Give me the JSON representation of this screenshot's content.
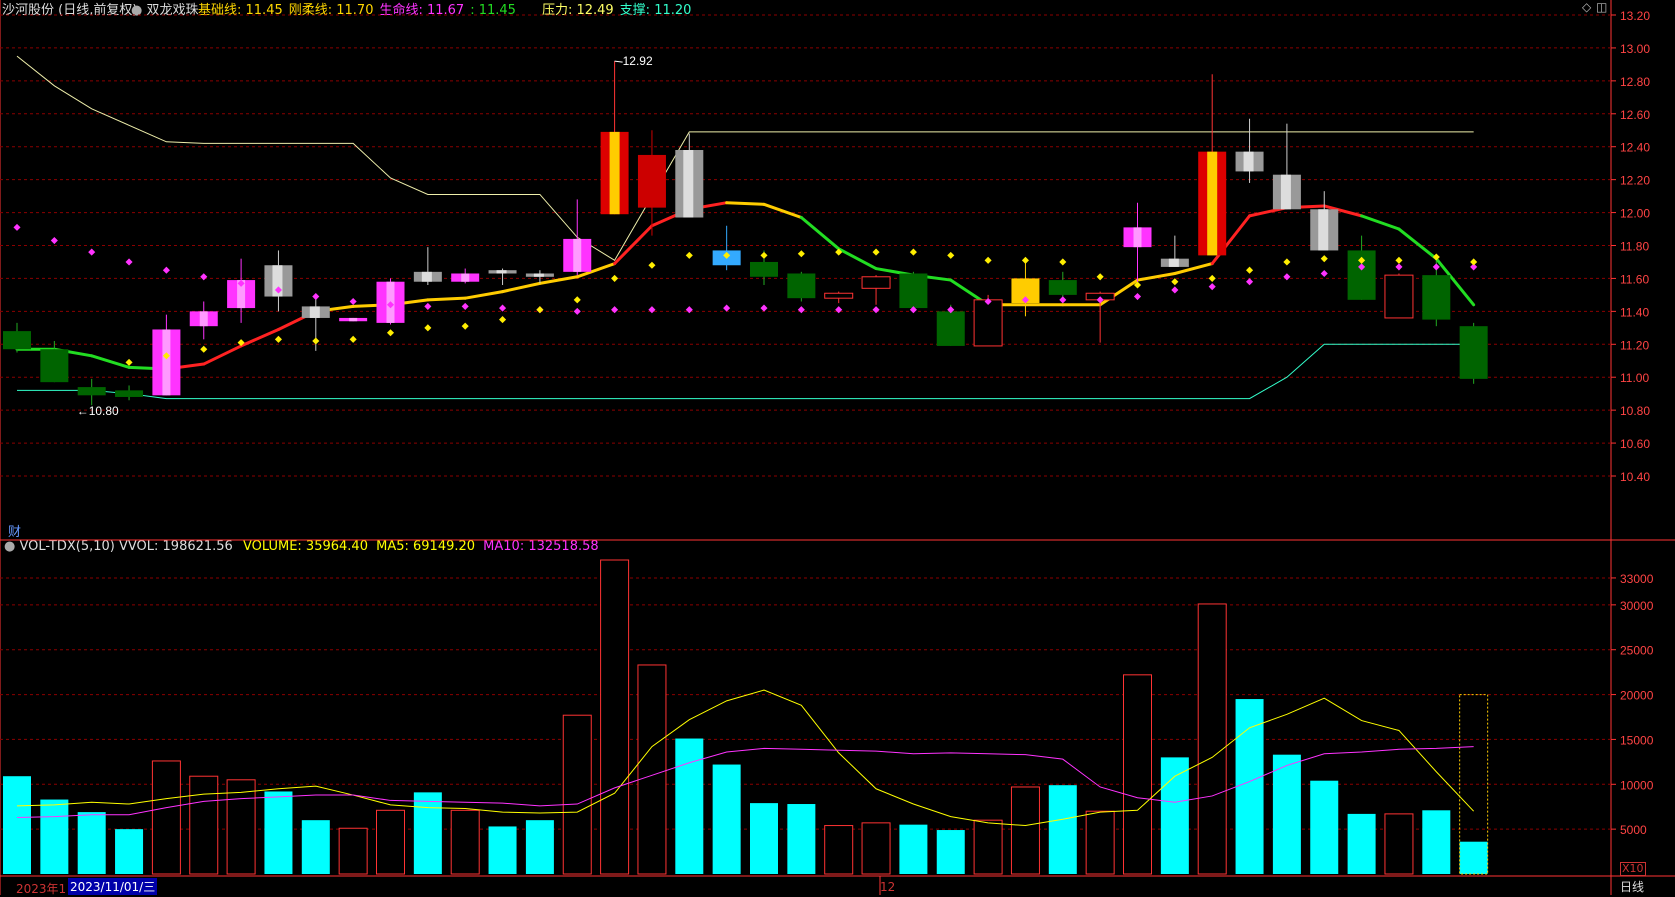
{
  "header": {
    "stock_name": "沙河股份",
    "chart_mode": "(日线,前复权)",
    "indicator_name": "双龙戏珠",
    "items": [
      {
        "label": "基础线: ",
        "value": "11.45",
        "color": "#FFD700"
      },
      {
        "label": "刚柔线: ",
        "value": "11.70",
        "color": "#FFD700"
      },
      {
        "label": "生命线: ",
        "value": "11.67",
        "color": "#FF33FF"
      },
      {
        "label": ": ",
        "value": "11.45",
        "color": "#22DD22"
      },
      {
        "label": "压力: ",
        "value": "12.49",
        "color": "#FFFF66"
      },
      {
        "label": "支撑: ",
        "value": "11.20",
        "color": "#33FFCC"
      }
    ]
  },
  "vol_header": {
    "name": "VOL-TDX(5,10)",
    "vvol": "VVOL: 198621.56",
    "volume": "VOLUME: 35964.40",
    "ma5": "MA5: 69149.20",
    "ma10": "MA10: 132518.58"
  },
  "finance_marker": "财",
  "date_bar": {
    "year": "2023年1",
    "date": "2023/11/01/三",
    "month": "12",
    "period": "日线",
    "multiplier": "X10"
  },
  "colors": {
    "up": "#FF3333",
    "down": "#00FFFF",
    "ma5": "#FFFF00",
    "ma10": "#FF33FF",
    "grid": "#8B0000",
    "axis": "#FF3333"
  },
  "chart_data": {
    "type": "candlestick",
    "price_axis": {
      "range": [
        10.4,
        13.2
      ],
      "ticks": [
        "13.20",
        "13.00",
        "12.80",
        "12.60",
        "12.40",
        "12.20",
        "12.00",
        "11.80",
        "11.60",
        "11.40",
        "11.20",
        "11.00",
        "10.80",
        "10.60",
        "10.40"
      ]
    },
    "annotations": [
      {
        "text": "12.92",
        "bar": 16,
        "price": 12.92
      },
      {
        "text": "10.80",
        "bar": 2,
        "price": 10.8
      }
    ],
    "candles": [
      {
        "o": 11.28,
        "h": 11.33,
        "l": 11.15,
        "c": 11.17,
        "col": "#006400"
      },
      {
        "o": 11.17,
        "h": 11.22,
        "l": 10.97,
        "c": 10.97,
        "col": "#006400"
      },
      {
        "o": 10.94,
        "h": 10.99,
        "l": 10.83,
        "c": 10.89,
        "col": "#006400"
      },
      {
        "o": 10.92,
        "h": 10.95,
        "l": 10.86,
        "c": 10.88,
        "col": "#006400"
      },
      {
        "o": 10.89,
        "h": 11.38,
        "l": 10.89,
        "c": 11.29,
        "col": "#FF33FF"
      },
      {
        "o": 11.31,
        "h": 11.46,
        "l": 11.23,
        "c": 11.4,
        "col": "#FF33FF"
      },
      {
        "o": 11.42,
        "h": 11.72,
        "l": 11.33,
        "c": 11.59,
        "col": "#FF33FF"
      },
      {
        "o": 11.68,
        "h": 11.77,
        "l": 11.4,
        "c": 11.49,
        "col": "#999999"
      },
      {
        "o": 11.43,
        "h": 11.48,
        "l": 11.16,
        "c": 11.36,
        "col": "#999999"
      },
      {
        "o": 11.34,
        "h": 11.36,
        "l": 11.34,
        "c": 11.36,
        "col": "#FF33FF"
      },
      {
        "o": 11.33,
        "h": 11.6,
        "l": 11.32,
        "c": 11.58,
        "col": "#FF33FF"
      },
      {
        "o": 11.64,
        "h": 11.79,
        "l": 11.56,
        "c": 11.58,
        "col": "#999999"
      },
      {
        "o": 11.58,
        "h": 11.66,
        "l": 11.57,
        "c": 11.63,
        "col": "#FF33FF"
      },
      {
        "o": 11.65,
        "h": 11.66,
        "l": 11.56,
        "c": 11.63,
        "col": "#999999"
      },
      {
        "o": 11.61,
        "h": 11.65,
        "l": 11.57,
        "c": 11.63,
        "col": "#999999"
      },
      {
        "o": 11.64,
        "h": 12.08,
        "l": 11.62,
        "c": 11.84,
        "col": "#FF33FF"
      },
      {
        "o": 11.99,
        "h": 12.92,
        "l": 11.99,
        "c": 12.49,
        "col": "gold"
      },
      {
        "o": 12.35,
        "h": 12.5,
        "l": 11.86,
        "c": 12.03,
        "col": "#CC0000"
      },
      {
        "o": 12.38,
        "h": 12.48,
        "l": 11.97,
        "c": 11.97,
        "col": "#999999"
      },
      {
        "o": 11.77,
        "h": 11.92,
        "l": 11.65,
        "c": 11.68,
        "col": "#33AAFF"
      },
      {
        "o": 11.7,
        "h": 11.77,
        "l": 11.56,
        "c": 11.61,
        "col": "#006400"
      },
      {
        "o": 11.63,
        "h": 11.64,
        "l": 11.46,
        "c": 11.48,
        "col": "#006400"
      },
      {
        "o": 11.48,
        "h": 11.52,
        "l": 11.45,
        "c": 11.51,
        "col": "hollow"
      },
      {
        "o": 11.54,
        "h": 11.62,
        "l": 11.44,
        "c": 11.61,
        "col": "hollow"
      },
      {
        "o": 11.63,
        "h": 11.64,
        "l": 11.4,
        "c": 11.42,
        "col": "#006400"
      },
      {
        "o": 11.4,
        "h": 11.44,
        "l": 11.19,
        "c": 11.19,
        "col": "#006400"
      },
      {
        "o": 11.19,
        "h": 11.5,
        "l": 11.19,
        "c": 11.47,
        "col": "hollow"
      },
      {
        "o": 11.45,
        "h": 11.7,
        "l": 11.37,
        "c": 11.6,
        "col": "#FFCC00"
      },
      {
        "o": 11.59,
        "h": 11.64,
        "l": 11.48,
        "c": 11.5,
        "col": "#006400"
      },
      {
        "o": 11.47,
        "h": 11.52,
        "l": 11.21,
        "c": 11.51,
        "col": "hollow"
      },
      {
        "o": 11.79,
        "h": 12.06,
        "l": 11.55,
        "c": 11.91,
        "col": "#FF33FF"
      },
      {
        "o": 11.72,
        "h": 11.86,
        "l": 11.67,
        "c": 11.67,
        "col": "#999999"
      },
      {
        "o": 11.74,
        "h": 12.84,
        "l": 11.74,
        "c": 12.37,
        "col": "gold"
      },
      {
        "o": 12.37,
        "h": 12.57,
        "l": 12.18,
        "c": 12.25,
        "col": "#999999"
      },
      {
        "o": 12.23,
        "h": 12.54,
        "l": 12.02,
        "c": 12.02,
        "col": "#999999"
      },
      {
        "o": 12.02,
        "h": 12.13,
        "l": 11.77,
        "c": 11.77,
        "col": "#999999"
      },
      {
        "o": 11.77,
        "h": 11.86,
        "l": 11.47,
        "c": 11.47,
        "col": "#006400"
      },
      {
        "o": 11.36,
        "h": 11.63,
        "l": 11.36,
        "c": 11.62,
        "col": "hollow"
      },
      {
        "o": 11.62,
        "h": 11.71,
        "l": 11.31,
        "c": 11.35,
        "col": "#006400"
      },
      {
        "o": 11.31,
        "h": 11.33,
        "l": 10.96,
        "c": 10.99,
        "col": "#006400"
      }
    ],
    "lifeline": [
      11.17,
      11.17,
      11.13,
      11.06,
      11.05,
      11.08,
      11.19,
      11.29,
      11.4,
      11.43,
      11.44,
      11.47,
      11.48,
      11.52,
      11.57,
      11.61,
      11.69,
      11.92,
      12.02,
      12.06,
      12.05,
      11.97,
      11.78,
      11.66,
      11.62,
      11.59,
      11.44,
      11.44,
      11.44,
      11.44,
      11.59,
      11.63,
      11.69,
      11.98,
      12.03,
      12.04,
      11.98,
      11.9,
      11.72,
      11.44
    ],
    "line_colors": [
      "#22DD22",
      "#22DD22",
      "#22DD22",
      "#22DD22",
      "#FF2222",
      "#FF2222",
      "#FF2222",
      "#FF2222",
      "#FFCC00",
      "#FFCC00",
      "#FFCC00",
      "#FFCC00",
      "#FFCC00",
      "#FFCC00",
      "#FFCC00",
      "#FFCC00",
      "#FF2222",
      "#FF2222",
      "#FF2222",
      "#FFCC00",
      "#FFCC00",
      "#22DD22",
      "#22DD22",
      "#22DD22",
      "#22DD22",
      "#22DD22",
      "#FFCC00",
      "#FFCC00",
      "#FFCC00",
      "#FFCC00",
      "#FFCC00",
      "#FFCC00",
      "#FF2222",
      "#FF2222",
      "#FF2222",
      "#FF2222",
      "#22DD22",
      "#22DD22",
      "#22DD22",
      "#22DD22"
    ],
    "resistance": [
      12.95,
      12.77,
      12.63,
      12.53,
      12.43,
      12.42,
      12.42,
      12.42,
      12.42,
      12.42,
      12.21,
      12.11,
      12.11,
      12.11,
      12.11,
      11.85,
      11.71,
      12.1,
      12.49,
      12.49,
      12.49,
      12.49,
      12.49,
      12.49,
      12.49,
      12.49,
      12.49,
      12.49,
      12.49,
      12.49,
      12.49,
      12.49,
      12.49,
      12.49,
      12.49,
      12.49,
      12.49,
      12.49,
      12.49,
      12.49
    ],
    "support": [
      10.92,
      10.92,
      10.92,
      10.9,
      10.87,
      10.87,
      10.87,
      10.87,
      10.87,
      10.87,
      10.87,
      10.87,
      10.87,
      10.87,
      10.87,
      10.87,
      10.87,
      10.87,
      10.87,
      10.87,
      10.87,
      10.87,
      10.87,
      10.87,
      10.87,
      10.87,
      10.87,
      10.87,
      10.87,
      10.87,
      10.87,
      10.87,
      10.87,
      10.87,
      11.0,
      11.2,
      11.2,
      11.2,
      11.2,
      11.2
    ],
    "dots_magenta": [
      11.91,
      11.83,
      11.76,
      11.7,
      11.65,
      11.61,
      11.57,
      11.53,
      11.49,
      11.46,
      11.44,
      11.43,
      11.43,
      11.42,
      11.41,
      11.4,
      11.41,
      11.41,
      11.41,
      11.42,
      11.42,
      11.41,
      11.41,
      11.41,
      11.41,
      11.41,
      11.46,
      11.47,
      11.47,
      11.47,
      11.49,
      11.53,
      11.55,
      11.58,
      11.61,
      11.63,
      11.67,
      11.67,
      11.67,
      11.67
    ],
    "dots_yellow": [
      null,
      null,
      null,
      11.09,
      11.13,
      11.17,
      11.21,
      11.23,
      11.22,
      11.23,
      11.27,
      11.3,
      11.31,
      11.35,
      11.41,
      11.47,
      11.6,
      11.68,
      11.74,
      11.74,
      11.74,
      11.75,
      11.76,
      11.76,
      11.76,
      11.74,
      11.71,
      11.71,
      11.7,
      11.61,
      11.56,
      11.58,
      11.6,
      11.65,
      11.7,
      11.72,
      11.71,
      11.71,
      11.73,
      11.7
    ],
    "volume_axis": {
      "range": [
        0,
        35000
      ],
      "ticks": [
        "33000",
        "30000",
        "25000",
        "20000",
        "15000",
        "10000",
        "5000"
      ]
    },
    "volume": [
      {
        "v": 10900,
        "up": false
      },
      {
        "v": 8300,
        "up": false
      },
      {
        "v": 6900,
        "up": false
      },
      {
        "v": 5000,
        "up": false
      },
      {
        "v": 12600,
        "up": true
      },
      {
        "v": 10900,
        "up": true
      },
      {
        "v": 10500,
        "up": true
      },
      {
        "v": 9200,
        "up": false
      },
      {
        "v": 6000,
        "up": false
      },
      {
        "v": 5100,
        "up": true
      },
      {
        "v": 7100,
        "up": true
      },
      {
        "v": 9100,
        "up": false
      },
      {
        "v": 7100,
        "up": true
      },
      {
        "v": 5300,
        "up": false
      },
      {
        "v": 6000,
        "up": false
      },
      {
        "v": 17700,
        "up": true
      },
      {
        "v": 35000,
        "up": true
      },
      {
        "v": 23300,
        "up": true
      },
      {
        "v": 15100,
        "up": false
      },
      {
        "v": 12200,
        "up": false
      },
      {
        "v": 7900,
        "up": false
      },
      {
        "v": 7800,
        "up": false
      },
      {
        "v": 5400,
        "up": true
      },
      {
        "v": 5700,
        "up": true
      },
      {
        "v": 5500,
        "up": false
      },
      {
        "v": 4900,
        "up": false
      },
      {
        "v": 6000,
        "up": true
      },
      {
        "v": 9700,
        "up": true
      },
      {
        "v": 9900,
        "up": false
      },
      {
        "v": 7000,
        "up": true
      },
      {
        "v": 22200,
        "up": true
      },
      {
        "v": 13000,
        "up": false
      },
      {
        "v": 30100,
        "up": true
      },
      {
        "v": 19500,
        "up": false
      },
      {
        "v": 13300,
        "up": false
      },
      {
        "v": 10400,
        "up": false
      },
      {
        "v": 6700,
        "up": false
      },
      {
        "v": 6700,
        "up": true
      },
      {
        "v": 7100,
        "up": false
      },
      {
        "v": 3600,
        "up": false
      }
    ],
    "volume_latest_dotted": 20000,
    "ma5": [
      7600,
      7700,
      8000,
      7800,
      8400,
      8900,
      9100,
      9500,
      9800,
      8800,
      7700,
      7400,
      7300,
      6900,
      6800,
      6900,
      9000,
      14200,
      17200,
      19300,
      20500,
      18800,
      13500,
      9500,
      7800,
      6400,
      5700,
      5400,
      6100,
      6900,
      7100,
      10900,
      13000,
      16300,
      17800,
      19600,
      17100,
      16000,
      11400,
      7000
    ],
    "ma10": [
      6300,
      6400,
      6600,
      6600,
      7400,
      8100,
      8400,
      8600,
      8800,
      8800,
      8200,
      8100,
      8000,
      7900,
      7600,
      7800,
      9600,
      11000,
      12400,
      13600,
      14000,
      13900,
      13800,
      13700,
      13400,
      13500,
      13400,
      13300,
      12800,
      9700,
      8500,
      8000,
      8700,
      10300,
      12100,
      13400,
      13600,
      13900,
      14000,
      14200
    ]
  }
}
